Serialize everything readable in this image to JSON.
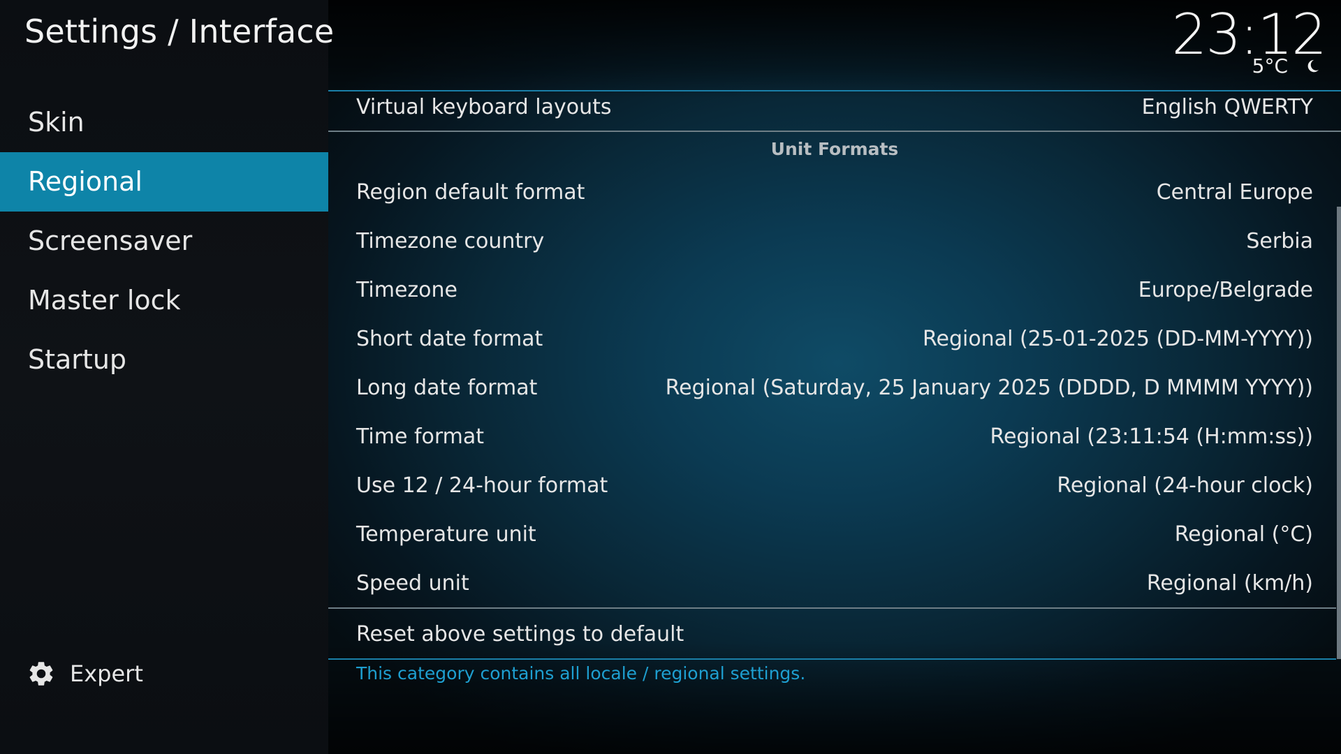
{
  "header": {
    "title": "Settings / Interface",
    "clock": "23:12",
    "weather": {
      "temperature": "5°C",
      "icon": "moon-icon"
    }
  },
  "sidebar": {
    "items": [
      {
        "label": "Skin",
        "active": false
      },
      {
        "label": "Regional",
        "active": true
      },
      {
        "label": "Screensaver",
        "active": false
      },
      {
        "label": "Master lock",
        "active": false
      },
      {
        "label": "Startup",
        "active": false
      }
    ],
    "expert": {
      "label": "Expert",
      "icon": "gear-icon"
    }
  },
  "settings": {
    "keyboard": {
      "label": "Virtual keyboard layouts",
      "value": "English QWERTY"
    },
    "section_heading": "Unit Formats",
    "rows": [
      {
        "label": "Region default format",
        "value": "Central Europe"
      },
      {
        "label": "Timezone country",
        "value": "Serbia"
      },
      {
        "label": "Timezone",
        "value": "Europe/Belgrade"
      },
      {
        "label": "Short date format",
        "value": "Regional (25-01-2025 (DD-MM-YYYY))"
      },
      {
        "label": "Long date format",
        "value": "Regional (Saturday, 25 January 2025 (DDDD, D MMMM YYYY))"
      },
      {
        "label": "Time format",
        "value": "Regional (23:11:54 (H:mm:ss))"
      },
      {
        "label": "Use 12 / 24-hour format",
        "value": "Regional (24-hour clock)"
      },
      {
        "label": "Temperature unit",
        "value": "Regional (°C)"
      },
      {
        "label": "Speed unit",
        "value": "Regional (km/h)"
      }
    ],
    "reset": {
      "label": "Reset above settings to default"
    },
    "description": "This category contains all locale / regional settings."
  },
  "colors": {
    "accent": "#0e84a8",
    "description": "#1e9fd0"
  }
}
